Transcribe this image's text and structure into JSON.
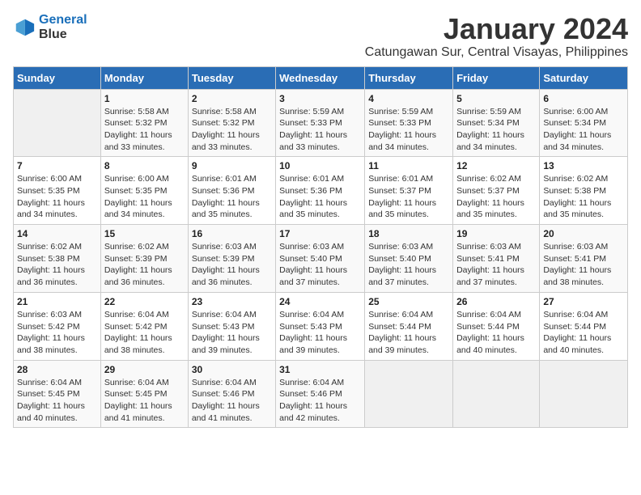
{
  "logo": {
    "line1": "General",
    "line2": "Blue"
  },
  "title": "January 2024",
  "location": "Catungawan Sur, Central Visayas, Philippines",
  "header": {
    "days": [
      "Sunday",
      "Monday",
      "Tuesday",
      "Wednesday",
      "Thursday",
      "Friday",
      "Saturday"
    ]
  },
  "weeks": [
    [
      {
        "day": "",
        "info": ""
      },
      {
        "day": "1",
        "info": "Sunrise: 5:58 AM\nSunset: 5:32 PM\nDaylight: 11 hours\nand 33 minutes."
      },
      {
        "day": "2",
        "info": "Sunrise: 5:58 AM\nSunset: 5:32 PM\nDaylight: 11 hours\nand 33 minutes."
      },
      {
        "day": "3",
        "info": "Sunrise: 5:59 AM\nSunset: 5:33 PM\nDaylight: 11 hours\nand 33 minutes."
      },
      {
        "day": "4",
        "info": "Sunrise: 5:59 AM\nSunset: 5:33 PM\nDaylight: 11 hours\nand 34 minutes."
      },
      {
        "day": "5",
        "info": "Sunrise: 5:59 AM\nSunset: 5:34 PM\nDaylight: 11 hours\nand 34 minutes."
      },
      {
        "day": "6",
        "info": "Sunrise: 6:00 AM\nSunset: 5:34 PM\nDaylight: 11 hours\nand 34 minutes."
      }
    ],
    [
      {
        "day": "7",
        "info": "Sunrise: 6:00 AM\nSunset: 5:35 PM\nDaylight: 11 hours\nand 34 minutes."
      },
      {
        "day": "8",
        "info": "Sunrise: 6:00 AM\nSunset: 5:35 PM\nDaylight: 11 hours\nand 34 minutes."
      },
      {
        "day": "9",
        "info": "Sunrise: 6:01 AM\nSunset: 5:36 PM\nDaylight: 11 hours\nand 35 minutes."
      },
      {
        "day": "10",
        "info": "Sunrise: 6:01 AM\nSunset: 5:36 PM\nDaylight: 11 hours\nand 35 minutes."
      },
      {
        "day": "11",
        "info": "Sunrise: 6:01 AM\nSunset: 5:37 PM\nDaylight: 11 hours\nand 35 minutes."
      },
      {
        "day": "12",
        "info": "Sunrise: 6:02 AM\nSunset: 5:37 PM\nDaylight: 11 hours\nand 35 minutes."
      },
      {
        "day": "13",
        "info": "Sunrise: 6:02 AM\nSunset: 5:38 PM\nDaylight: 11 hours\nand 35 minutes."
      }
    ],
    [
      {
        "day": "14",
        "info": "Sunrise: 6:02 AM\nSunset: 5:38 PM\nDaylight: 11 hours\nand 36 minutes."
      },
      {
        "day": "15",
        "info": "Sunrise: 6:02 AM\nSunset: 5:39 PM\nDaylight: 11 hours\nand 36 minutes."
      },
      {
        "day": "16",
        "info": "Sunrise: 6:03 AM\nSunset: 5:39 PM\nDaylight: 11 hours\nand 36 minutes."
      },
      {
        "day": "17",
        "info": "Sunrise: 6:03 AM\nSunset: 5:40 PM\nDaylight: 11 hours\nand 37 minutes."
      },
      {
        "day": "18",
        "info": "Sunrise: 6:03 AM\nSunset: 5:40 PM\nDaylight: 11 hours\nand 37 minutes."
      },
      {
        "day": "19",
        "info": "Sunrise: 6:03 AM\nSunset: 5:41 PM\nDaylight: 11 hours\nand 37 minutes."
      },
      {
        "day": "20",
        "info": "Sunrise: 6:03 AM\nSunset: 5:41 PM\nDaylight: 11 hours\nand 38 minutes."
      }
    ],
    [
      {
        "day": "21",
        "info": "Sunrise: 6:03 AM\nSunset: 5:42 PM\nDaylight: 11 hours\nand 38 minutes."
      },
      {
        "day": "22",
        "info": "Sunrise: 6:04 AM\nSunset: 5:42 PM\nDaylight: 11 hours\nand 38 minutes."
      },
      {
        "day": "23",
        "info": "Sunrise: 6:04 AM\nSunset: 5:43 PM\nDaylight: 11 hours\nand 39 minutes."
      },
      {
        "day": "24",
        "info": "Sunrise: 6:04 AM\nSunset: 5:43 PM\nDaylight: 11 hours\nand 39 minutes."
      },
      {
        "day": "25",
        "info": "Sunrise: 6:04 AM\nSunset: 5:44 PM\nDaylight: 11 hours\nand 39 minutes."
      },
      {
        "day": "26",
        "info": "Sunrise: 6:04 AM\nSunset: 5:44 PM\nDaylight: 11 hours\nand 40 minutes."
      },
      {
        "day": "27",
        "info": "Sunrise: 6:04 AM\nSunset: 5:44 PM\nDaylight: 11 hours\nand 40 minutes."
      }
    ],
    [
      {
        "day": "28",
        "info": "Sunrise: 6:04 AM\nSunset: 5:45 PM\nDaylight: 11 hours\nand 40 minutes."
      },
      {
        "day": "29",
        "info": "Sunrise: 6:04 AM\nSunset: 5:45 PM\nDaylight: 11 hours\nand 41 minutes."
      },
      {
        "day": "30",
        "info": "Sunrise: 6:04 AM\nSunset: 5:46 PM\nDaylight: 11 hours\nand 41 minutes."
      },
      {
        "day": "31",
        "info": "Sunrise: 6:04 AM\nSunset: 5:46 PM\nDaylight: 11 hours\nand 42 minutes."
      },
      {
        "day": "",
        "info": ""
      },
      {
        "day": "",
        "info": ""
      },
      {
        "day": "",
        "info": ""
      }
    ]
  ]
}
